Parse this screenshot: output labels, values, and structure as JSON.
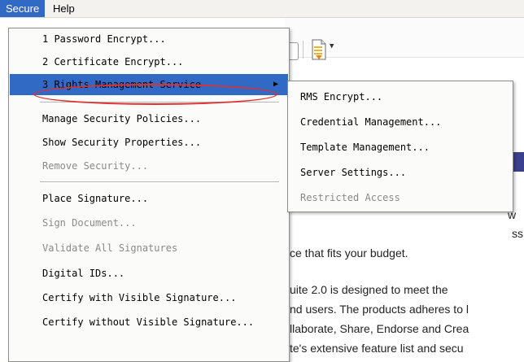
{
  "menubar": {
    "items": [
      {
        "label": "Secure",
        "active": true
      },
      {
        "label": "Help",
        "active": false
      }
    ]
  },
  "toolbar": {
    "icons": [
      "document-icon",
      "dropdown-arrow-icon"
    ]
  },
  "secure_menu": {
    "items": [
      {
        "label": "1 Password Encrypt...",
        "disabled": false
      },
      {
        "label": "2 Certificate Encrypt...",
        "disabled": false
      },
      {
        "label": "3 Rights Management Service",
        "disabled": false,
        "highlighted": true,
        "submenu_arrow": "▶"
      },
      {
        "label": "Manage Security Policies...",
        "disabled": false
      },
      {
        "label": "Show Security Properties...",
        "disabled": false
      },
      {
        "label": "Remove Security...",
        "disabled": true
      },
      {
        "label": "Place Signature...",
        "disabled": false
      },
      {
        "label": "Sign Document...",
        "disabled": true
      },
      {
        "label": "Validate All Signatures",
        "disabled": true
      },
      {
        "label": "Digital IDs...",
        "disabled": false
      },
      {
        "label": "Certify with Visible Signature...",
        "disabled": false
      },
      {
        "label": "Certify without Visible Signature...",
        "disabled": false
      }
    ]
  },
  "rms_submenu": {
    "items": [
      {
        "label": "RMS Encrypt...",
        "disabled": false
      },
      {
        "label": "Credential Management...",
        "disabled": false
      },
      {
        "label": "Template Management...",
        "disabled": false
      },
      {
        "label": "Server Settings...",
        "disabled": false
      },
      {
        "label": "Restricted Access",
        "disabled": true
      }
    ]
  },
  "document": {
    "lines": [
      "w",
      "ss",
      "ce that fits your budget.",
      "uite 2.0 is designed to meet the",
      "nd users. The products adheres to l",
      "llaborate, Share, Endorse and Crea",
      "te's extensive feature list and secu"
    ]
  },
  "colors": {
    "highlight": "#316ac5",
    "annotation": "#e03030",
    "purple_bar": "#3b3f8f"
  }
}
